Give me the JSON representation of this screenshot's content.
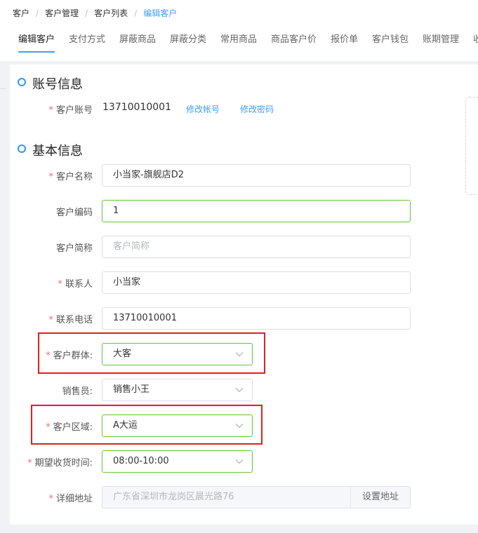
{
  "breadcrumb": [
    "客户",
    "客户管理",
    "客户列表",
    "编辑客户"
  ],
  "breadcrumb_sep": "/",
  "tabs": [
    "编辑客户",
    "支付方式",
    "屏蔽商品",
    "屏蔽分类",
    "常用商品",
    "商品客户价",
    "报价单",
    "客户钱包",
    "账期管理",
    "收"
  ],
  "active_tab": "编辑客户",
  "account": {
    "title": "账号信息",
    "label": "客户账号",
    "value": "13710010001",
    "edit_account": "修改帐号",
    "edit_password": "修改密码"
  },
  "basic": {
    "title": "基本信息",
    "fields": {
      "name": {
        "label": "客户名称",
        "value": "小当家-旗舰店D2",
        "required": true
      },
      "code": {
        "label": "客户编码",
        "value": "1",
        "required": false
      },
      "short": {
        "label": "客户简称",
        "placeholder": "客户简称",
        "required": false
      },
      "contact": {
        "label": "联系人",
        "value": "小当家",
        "required": true
      },
      "phone": {
        "label": "联系电话",
        "value": "13710010001",
        "required": true
      },
      "group": {
        "label": "客户群体:",
        "value": "大客",
        "required": true
      },
      "sales": {
        "label": "销售员:",
        "value": "销售小王",
        "required": false
      },
      "region": {
        "label": "客户区域:",
        "value": "A大运",
        "required": true
      },
      "time": {
        "label": "期望收货时间:",
        "value": "08:00-10:00",
        "required": true
      },
      "address": {
        "label": "详细地址",
        "value": "广东省深圳市龙岗区晨光路76",
        "button": "设置地址",
        "required": true
      }
    }
  },
  "colors": {
    "accent": "#409eff",
    "required": "#f56c6c",
    "focus_border": "#67c23a",
    "highlight_box": "#e02020"
  },
  "icons": {
    "select": "chevron-down-icon",
    "section": "circle-dot-icon"
  }
}
